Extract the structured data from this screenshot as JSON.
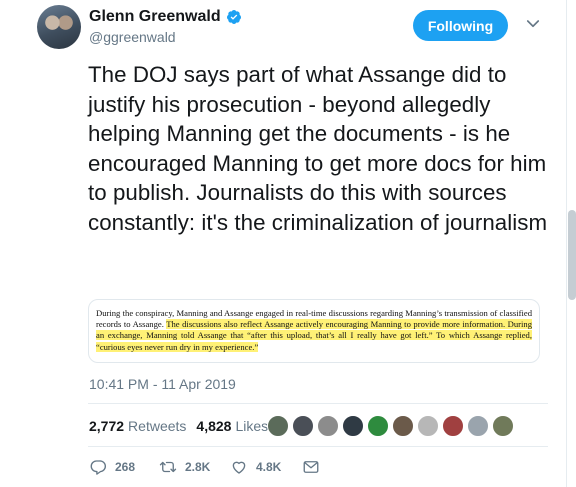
{
  "author": {
    "display_name": "Glenn Greenwald",
    "handle": "@ggreenwald",
    "verified": true
  },
  "follow_button": {
    "label": "Following"
  },
  "tweet": {
    "text": "The DOJ says part of what Assange did to justify his prosecution - beyond allegedly helping Manning get the documents - is he encouraged Manning to get more docs for him to publish. Journalists do this with sources constantly: it's the criminalization of journalism",
    "media": {
      "plain": "During the conspiracy, Manning and Assange engaged in real-time discussions regarding Manning’s transmission of classified records to Assange. ",
      "highlighted": "The discussions also reflect Assange actively encouraging Manning to provide more information. During an exchange, Manning told Assange that “after this upload, that’s all I really have got left.” To which Assange replied, “curious eyes never run dry in my experience.”"
    },
    "timestamp": "10:41 PM - 11 Apr 2019"
  },
  "stats": {
    "retweets_count": "2,772",
    "retweets_label": "Retweets",
    "likes_count": "4,828",
    "likes_label": "Likes"
  },
  "actions": {
    "reply_count": "268",
    "retweet_count": "2.8K",
    "like_count": "4.8K"
  },
  "colors": {
    "accent": "#1da1f2",
    "muted": "#657786",
    "highlight": "#fff176"
  },
  "likers": [
    "#5b6b5a",
    "#4a4f57",
    "#8c8c8c",
    "#2f3a44",
    "#2e8b3e",
    "#6b5a4a",
    "#b7b7b7",
    "#a04040",
    "#9aa4ad",
    "#707a5a"
  ]
}
